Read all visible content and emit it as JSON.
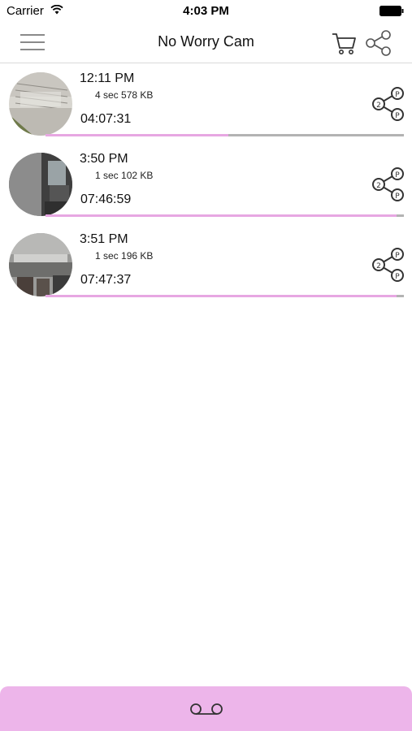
{
  "status_bar": {
    "carrier": "Carrier",
    "time": "4:03 PM",
    "wifi_icon": "wifi-icon",
    "battery_icon": "battery-icon"
  },
  "nav": {
    "title": "No Worry Cam",
    "menu_icon": "hamburger-menu-icon",
    "cart_icon": "cart-icon",
    "share_icon": "share-icon"
  },
  "recordings": [
    {
      "time": "12:11 PM",
      "meta": "4 sec 578 KB",
      "duration": "04:07:31",
      "progress": 0.51
    },
    {
      "time": "3:50 PM",
      "meta": "1 sec 102 KB",
      "duration": "07:46:59",
      "progress": 0.98
    },
    {
      "time": "3:51 PM",
      "meta": "1 sec 196 KB",
      "duration": "07:47:37",
      "progress": 0.98
    }
  ],
  "bottom_bar": {
    "icon": "voicemail-record-icon"
  },
  "colors": {
    "accent_pink": "#edb5ea",
    "progress_fill": "#e7a7e2",
    "progress_track": "#b3b3b3",
    "icon_gray": "#8a8a8a"
  }
}
